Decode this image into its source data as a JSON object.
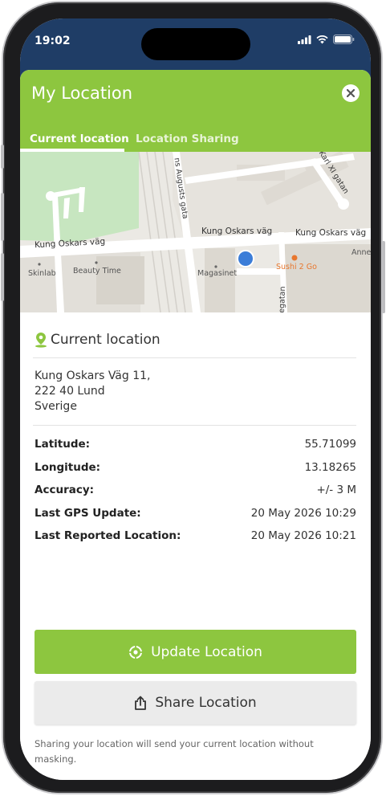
{
  "status_bar": {
    "time": "19:02"
  },
  "header": {
    "title": "My Location",
    "close_icon": "close-icon",
    "tabs": [
      {
        "label": "Current location",
        "active": true
      },
      {
        "label": "Location Sharing",
        "active": false
      }
    ]
  },
  "map": {
    "streets": {
      "kung_oskars_vag_1": "Kung Oskars väg",
      "kung_oskars_vag_2": "Kung Oskars väg",
      "kung_oskars_vag_3": "Kung Oskars väg",
      "st_augusts_gata": "ns Augusts gata",
      "karl_xi_gatan": "Karl XI gatan",
      "side_street": "legatan"
    },
    "pois": {
      "skinlab": "Skinlab",
      "beauty_time": "Beauty Time",
      "magasinet": "Magasinet",
      "sushi": "Sushi 2 Go",
      "annex": "Anne"
    }
  },
  "section": {
    "title": "Current location",
    "icon": "location-pin-icon"
  },
  "address": {
    "line1": "Kung Oskars Väg 11,",
    "line2": "222 40 Lund",
    "line3": "Sverige"
  },
  "details": [
    {
      "label": "Latitude:",
      "value": "55.71099"
    },
    {
      "label": "Longitude:",
      "value": "13.18265"
    },
    {
      "label": "Accuracy:",
      "value": "+/- 3 M"
    },
    {
      "label": "Last GPS Update:",
      "value": "20 May 2026 10:29"
    },
    {
      "label": "Last Reported Location:",
      "value": "20 May 2026 10:21"
    }
  ],
  "buttons": {
    "update": "Update Location",
    "share": "Share Location"
  },
  "note": "Sharing your location will send your current location without masking.",
  "colors": {
    "accent": "#8dc63f",
    "status_bar": "#1f3d66",
    "map_dot": "#3b7dd8",
    "sushi": "#e8772e"
  }
}
